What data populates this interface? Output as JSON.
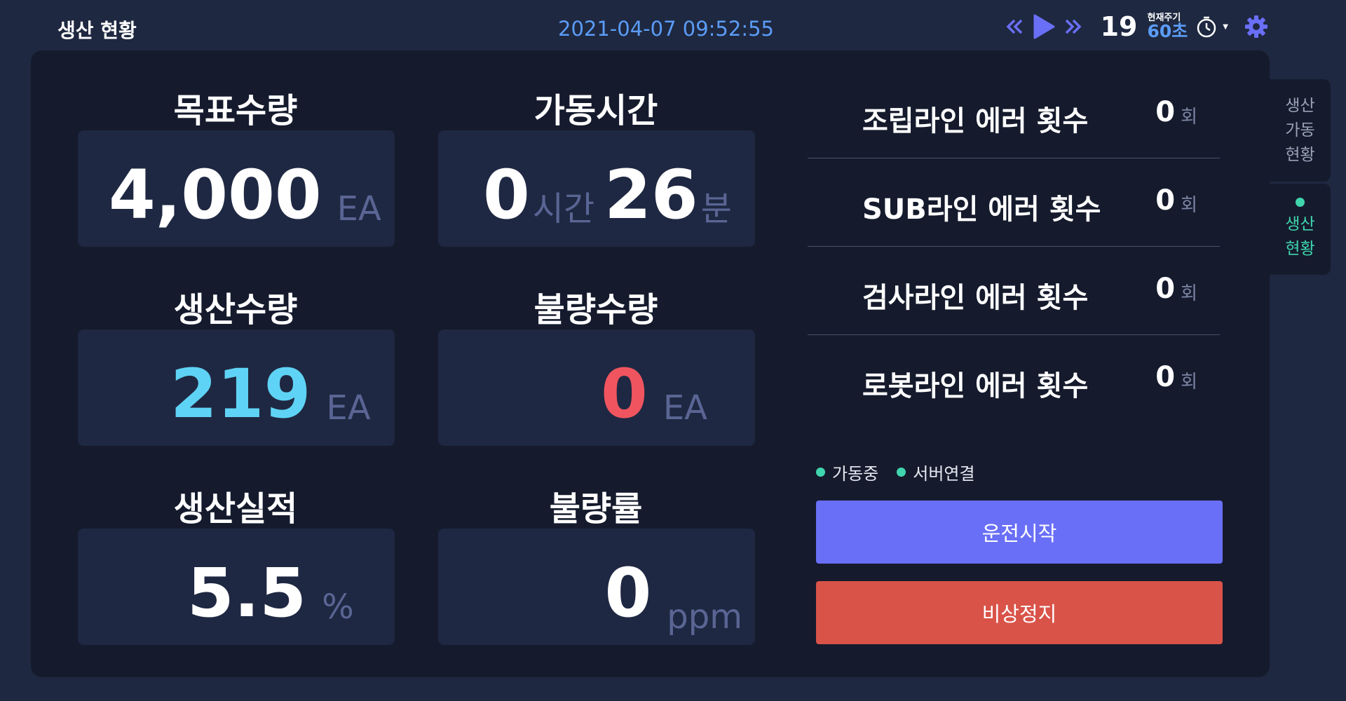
{
  "header": {
    "title": "생산 현황",
    "datetime": "2021-04-07 09:52:55",
    "cycle_count": "19",
    "cycle_label": "현재주기",
    "cycle_value": "60초",
    "icons": [
      "rewind-icon",
      "play-icon",
      "fast-forward-icon",
      "timer-icon",
      "gear-icon"
    ]
  },
  "metrics": {
    "target_qty": {
      "label": "목표수량",
      "value": "4,000",
      "unit": "EA"
    },
    "uptime": {
      "label": "가동시간",
      "hours": "0",
      "hours_unit": "시간",
      "minutes": "26",
      "minutes_unit": "분"
    },
    "production_qty": {
      "label": "생산수량",
      "value": "219",
      "unit": "EA"
    },
    "defect_qty": {
      "label": "불량수량",
      "value": "0",
      "unit": "EA"
    },
    "production_rate": {
      "label": "생산실적",
      "value": "5.5",
      "unit": "%"
    },
    "defect_rate": {
      "label": "불량률",
      "value": "0",
      "unit": "ppm"
    }
  },
  "errors": [
    {
      "label": "조립라인 에러 횟수",
      "value": "0",
      "unit": "회"
    },
    {
      "label": "SUB라인 에러 횟수",
      "value": "0",
      "unit": "회"
    },
    {
      "label": "검사라인 에러 횟수",
      "value": "0",
      "unit": "회"
    },
    {
      "label": "로봇라인 에러 횟수",
      "value": "0",
      "unit": "회"
    }
  ],
  "status": [
    {
      "label": "가동중"
    },
    {
      "label": "서버연결"
    }
  ],
  "buttons": {
    "start": "운전시작",
    "stop": "비상정지"
  },
  "side_tabs": [
    {
      "label": "생산\n가동\n현황",
      "active": false
    },
    {
      "label": "생산\n현황",
      "active": true
    }
  ],
  "colors": {
    "background": "#1e2840",
    "panel": "#151b2d",
    "box": "#1f2842",
    "accent_blue": "#5b9cf6",
    "production_value": "#5fd3f5",
    "defect_value": "#f0555f",
    "status_green": "#3fd6ae",
    "start_button": "#6a6ff7",
    "stop_button": "#d95349"
  }
}
